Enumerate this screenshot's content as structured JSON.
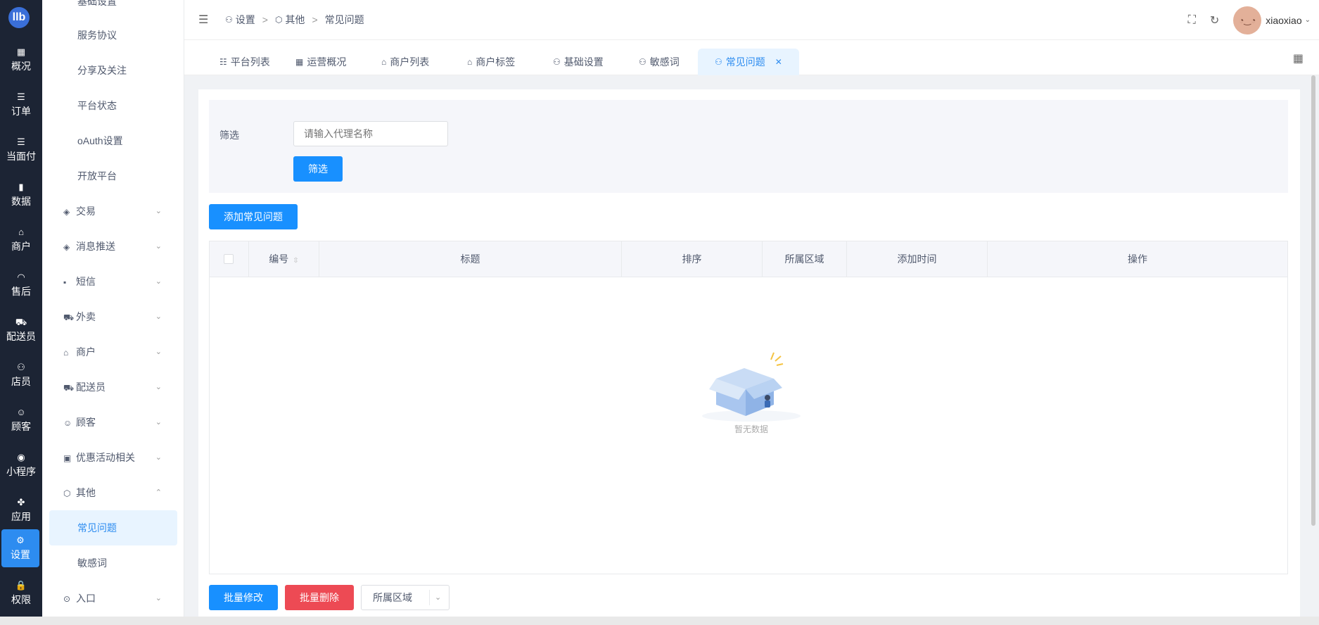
{
  "rail": {
    "logo": "llb",
    "items": [
      {
        "icon": "overview-icon",
        "glyph": "▦",
        "label": "概况"
      },
      {
        "icon": "order-icon",
        "glyph": "☰",
        "label": "订单"
      },
      {
        "icon": "pay-icon",
        "glyph": "☰",
        "label": "当面付"
      },
      {
        "icon": "data-icon",
        "glyph": "▮",
        "label": "数据"
      },
      {
        "icon": "store-icon",
        "glyph": "⌂",
        "label": "商户"
      },
      {
        "icon": "headset-icon",
        "glyph": "◠",
        "label": "售后"
      },
      {
        "icon": "courier-icon",
        "glyph": "⛟",
        "label": "配送员"
      },
      {
        "icon": "staff-icon",
        "glyph": "⚇",
        "label": "店员"
      },
      {
        "icon": "customer-icon",
        "glyph": "☺",
        "label": "顾客"
      },
      {
        "icon": "wechat-icon",
        "glyph": "◉",
        "label": "小程序"
      },
      {
        "icon": "apps-icon",
        "glyph": "✤",
        "label": "应用"
      },
      {
        "icon": "settings-icon",
        "glyph": "⚙",
        "label": "设置"
      },
      {
        "icon": "lock-icon",
        "glyph": "🔒",
        "label": "权限"
      }
    ]
  },
  "sidebar": {
    "top_cut": "基础设置",
    "subs": [
      "服务协议",
      "分享及关注",
      "平台状态",
      "oAuth设置",
      "开放平台"
    ],
    "groups": [
      {
        "icon": "trade-icon",
        "glyph": "◈",
        "label": "交易"
      },
      {
        "icon": "push-icon",
        "glyph": "◈",
        "label": "消息推送"
      },
      {
        "icon": "sms-icon",
        "glyph": "▪",
        "label": "短信"
      },
      {
        "icon": "takeout-icon",
        "glyph": "⛟",
        "label": "外卖"
      },
      {
        "icon": "merchant-icon",
        "glyph": "⌂",
        "label": "商户"
      },
      {
        "icon": "courier-icon",
        "glyph": "⛟",
        "label": "配送员"
      },
      {
        "icon": "customer-icon",
        "glyph": "☺",
        "label": "顾客"
      },
      {
        "icon": "gift-icon",
        "glyph": "▣",
        "label": "优惠活动相关"
      },
      {
        "icon": "other-icon",
        "glyph": "⬡",
        "label": "其他"
      }
    ],
    "other_subs": [
      "常见问题",
      "敏感词"
    ],
    "entry": {
      "icon": "entry-icon",
      "glyph": "⊙",
      "label": "入口"
    }
  },
  "header": {
    "breadcrumb": [
      {
        "icon": "user-settings-icon",
        "label": "设置"
      },
      {
        "icon": "other-icon",
        "label": "其他"
      },
      {
        "icon": "",
        "label": "常见问题"
      }
    ],
    "separator": ">",
    "username": "xiaoxiao"
  },
  "tabs": [
    {
      "icon": "list-icon",
      "glyph": "☷",
      "label": "平台列表"
    },
    {
      "icon": "grid-icon",
      "glyph": "▦",
      "label": "运营概况"
    },
    {
      "icon": "store-icon",
      "glyph": "⌂",
      "label": "商户列表"
    },
    {
      "icon": "store-icon",
      "glyph": "⌂",
      "label": "商户标签"
    },
    {
      "icon": "user-settings-icon",
      "glyph": "⚇",
      "label": "基础设置"
    },
    {
      "icon": "user-settings-icon",
      "glyph": "⚇",
      "label": "敏感词"
    },
    {
      "icon": "user-settings-icon",
      "glyph": "⚇",
      "label": "常见问题"
    }
  ],
  "filter": {
    "label": "筛选",
    "placeholder": "请输入代理名称",
    "button": "筛选"
  },
  "add_button": "添加常见问题",
  "table": {
    "columns": [
      "编号",
      "标题",
      "排序",
      "所属区域",
      "添加时间",
      "操作"
    ],
    "empty_text": "暂无数据"
  },
  "footer": {
    "batch_edit": "批量修改",
    "batch_delete": "批量删除",
    "region_select": "所属区域"
  },
  "colors": {
    "primary": "#1890ff",
    "danger": "#ed4a54",
    "rail_bg": "#1c2434",
    "active_bg": "#e8f4ff"
  }
}
